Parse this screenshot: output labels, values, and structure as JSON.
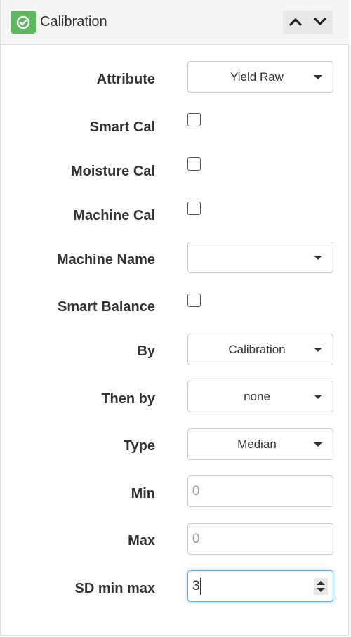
{
  "panel": {
    "title": "Calibration",
    "status_color": "#5cb85c",
    "header_icon": "check-circle-icon",
    "collapse_icon": "chevron-up-icon",
    "expand_icon": "chevron-down-icon"
  },
  "form": {
    "attribute": {
      "label": "Attribute",
      "value": "Yield Raw"
    },
    "smart_cal": {
      "label": "Smart Cal",
      "checked": false
    },
    "moisture_cal": {
      "label": "Moisture Cal",
      "checked": false
    },
    "machine_cal": {
      "label": "Machine Cal",
      "checked": false
    },
    "machine_name": {
      "label": "Machine Name",
      "value": ""
    },
    "smart_balance": {
      "label": "Smart Balance",
      "checked": false
    },
    "by": {
      "label": "By",
      "value": "Calibration"
    },
    "then_by": {
      "label": "Then by",
      "value": "none"
    },
    "type": {
      "label": "Type",
      "value": "Median"
    },
    "min": {
      "label": "Min",
      "placeholder": "0"
    },
    "max": {
      "label": "Max",
      "placeholder": "0"
    },
    "sd_min_max": {
      "label": "SD min max",
      "value": "3"
    }
  }
}
